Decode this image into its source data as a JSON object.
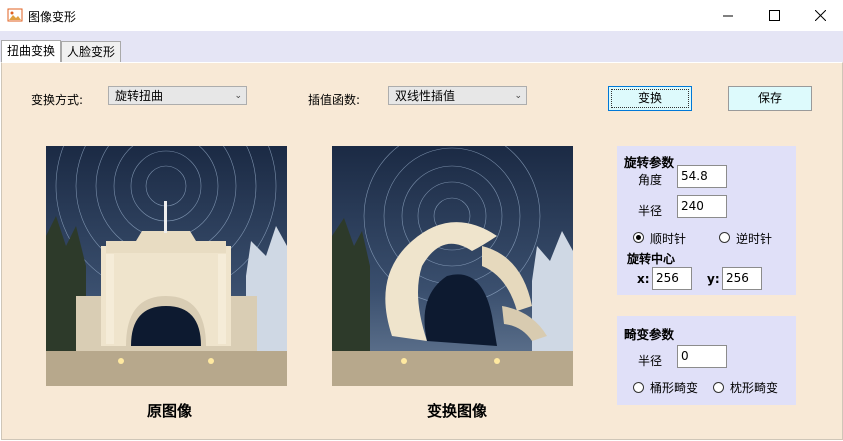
{
  "window": {
    "title": "图像变形",
    "icon": "image-app-icon",
    "controls": [
      "minimize-icon",
      "maximize-icon",
      "close-icon"
    ]
  },
  "tabs": [
    {
      "label": "扭曲变换",
      "active": true
    },
    {
      "label": "人脸变形",
      "active": false
    }
  ],
  "toolbar": {
    "transform_mode_label": "变换方式:",
    "transform_mode_value": "旋转扭曲",
    "interp_label": "插值函数:",
    "interp_value": "双线性插值",
    "transform_button": "变换",
    "save_button": "保存"
  },
  "images": {
    "original_caption": "原图像",
    "transformed_caption": "变换图像"
  },
  "rotation": {
    "title": "旋转参数",
    "angle_label": "角度",
    "angle_value": "54.8",
    "radius_label": "半径",
    "radius_value": "240",
    "clockwise_label": "顺时针",
    "counter_label": "逆时针",
    "selected_direction": "clockwise",
    "center_title": "旋转中心",
    "x_label": "x:",
    "x_value": "256",
    "y_label": "y:",
    "y_value": "256"
  },
  "distortion": {
    "title": "畸变参数",
    "radius_label": "半径",
    "radius_value": "0",
    "barrel_label": "桶形畸变",
    "pincushion_label": "枕形畸变"
  },
  "colors": {
    "panel_bg": "#f8e9d6",
    "tabstrip_bg": "#e5e5f5",
    "group_bg": "#e0e0f8",
    "button_bg": "#ddfafc"
  }
}
